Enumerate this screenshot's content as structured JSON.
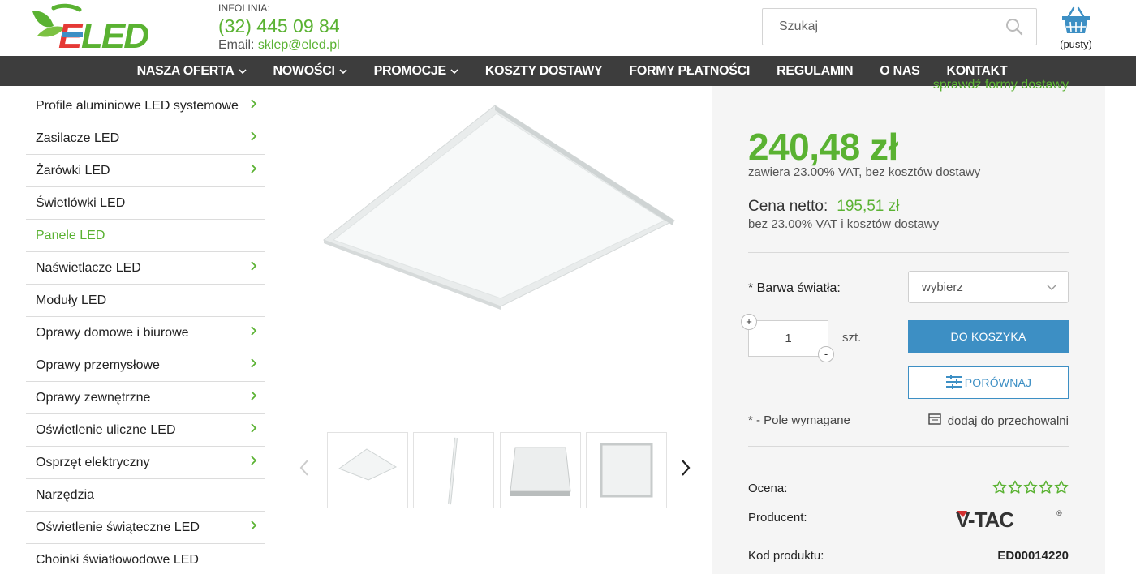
{
  "header": {
    "logo_text": "ELED",
    "info_label": "INFOLINIA:",
    "phone": "(32) 445 09 84",
    "email_label": "Email:",
    "email": "sklep@eled.pl",
    "search_placeholder": "Szukaj",
    "cart_label": "(pusty)"
  },
  "nav": {
    "items": [
      {
        "label": "NASZA OFERTA",
        "dropdown": true
      },
      {
        "label": "NOWOŚCI",
        "dropdown": true
      },
      {
        "label": "PROMOCJE",
        "dropdown": true
      },
      {
        "label": "KOSZTY DOSTAWY",
        "dropdown": false
      },
      {
        "label": "FORMY PŁATNOŚCI",
        "dropdown": false
      },
      {
        "label": "REGULAMIN",
        "dropdown": false
      },
      {
        "label": "O NAS",
        "dropdown": false
      },
      {
        "label": "KONTAKT",
        "dropdown": false
      }
    ]
  },
  "sidebar": {
    "items": [
      {
        "label": "Profile aluminiowe LED systemowe",
        "arrow": true
      },
      {
        "label": "Zasilacze LED",
        "arrow": true
      },
      {
        "label": "Żarówki LED",
        "arrow": true
      },
      {
        "label": "Świetlówki LED",
        "arrow": false
      },
      {
        "label": "Panele LED",
        "arrow": false,
        "active": true
      },
      {
        "label": "Naświetlacze LED",
        "arrow": true
      },
      {
        "label": "Moduły LED",
        "arrow": false
      },
      {
        "label": "Oprawy domowe i biurowe",
        "arrow": true
      },
      {
        "label": "Oprawy przemysłowe",
        "arrow": true
      },
      {
        "label": "Oprawy zewnętrzne",
        "arrow": true
      },
      {
        "label": "Oświetlenie uliczne LED",
        "arrow": true
      },
      {
        "label": "Osprzęt elektryczny",
        "arrow": true
      },
      {
        "label": "Narzędzia",
        "arrow": false
      },
      {
        "label": "Oświetlenie świąteczne LED",
        "arrow": true
      },
      {
        "label": "Choinki światłowodowe LED",
        "arrow": false
      }
    ]
  },
  "product": {
    "delivery_link": "sprawdź formy dostawy",
    "price": "240,48 zł",
    "vat_note": "zawiera 23.00% VAT, bez kosztów dostawy",
    "netto_label": "Cena netto:",
    "netto_value": "195,51 zł",
    "netto_note": "bez 23.00% VAT i kosztów dostawy",
    "color_label": "* Barwa światła:",
    "color_select": "wybierz",
    "quantity": "1",
    "qty_plus": "+",
    "qty_minus": "-",
    "unit": "szt.",
    "add_to_cart": "DO KOSZYKA",
    "compare": "PORÓWNAJ",
    "required_note": "* - Pole wymagane",
    "store_link": "dodaj do przechowalni",
    "rating_label": "Ocena:",
    "rating": 0,
    "rating_max": 5,
    "producer_label": "Producent:",
    "producer_logo": "V-TAC",
    "code_label": "Kod produktu:",
    "code": "ED00014220"
  },
  "colors": {
    "brand_green": "#5ab232",
    "nav_bg": "#3d3d3d",
    "button_blue": "#3d8fc4",
    "panel_bg": "#f5f5f5"
  }
}
